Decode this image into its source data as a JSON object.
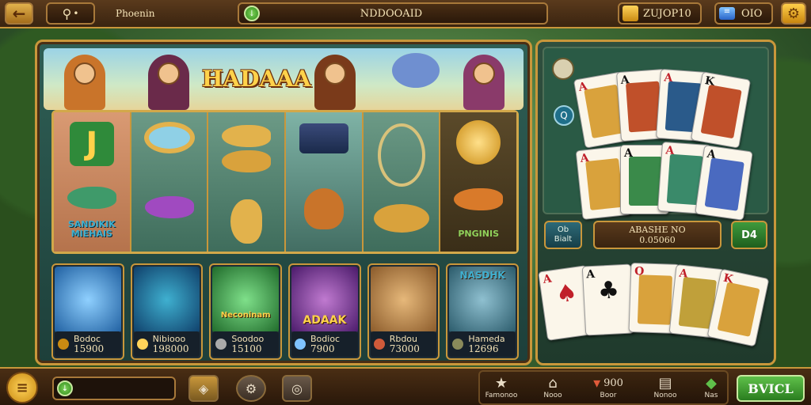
{
  "topbar": {
    "back_icon": "arrow-left-icon",
    "search_icon": "magnifier-icon",
    "player_name": "Phoenin",
    "balance_text": "NDDOOAID",
    "coins_value": "ZUJOР10",
    "gems_value": "OIO",
    "settings_icon": "gear-icon"
  },
  "slot": {
    "logo_text": "HADAAA",
    "reel1_label": "SANDIKIK MIEHAIS",
    "reel6_label": "PNGINIS"
  },
  "game_cards": [
    {
      "name": "Bodoc",
      "value": "15900",
      "overlay": ""
    },
    {
      "name": "Nibiooo",
      "value": "198000",
      "overlay": ""
    },
    {
      "name": "Soodoo",
      "value": "15100",
      "overlay": "Neconinam"
    },
    {
      "name": "Bodioc",
      "value": "7900",
      "overlay": "ADAAK"
    },
    {
      "name": "Rbdou",
      "value": "73000",
      "overlay": ""
    },
    {
      "name": "Hameda",
      "value": "12696",
      "overlay": "NASDHK"
    }
  ],
  "cards_panel": {
    "q_label": "Q",
    "bet_line1": "Ob",
    "bet_line2": "Bialt",
    "info_line1": "ABASHE NO",
    "info_line2": "0.05060",
    "deal_label": "D4"
  },
  "bottombar": {
    "menu_icon": "menu-icon",
    "nav_items": [
      {
        "icon": "star-icon",
        "label": "Famonoo"
      },
      {
        "icon": "house-icon",
        "label": "Nooo"
      },
      {
        "icon": "bucket-icon",
        "label": "Boor",
        "count": "900"
      },
      {
        "icon": "box-icon",
        "label": "Nonoo"
      },
      {
        "icon": "gift-icon",
        "label": "Nas"
      }
    ],
    "start_label": "BVICL"
  },
  "colors": {
    "gold": "#c9973b",
    "wood": "#4a2e14",
    "green_button": "#3f9a3c"
  }
}
